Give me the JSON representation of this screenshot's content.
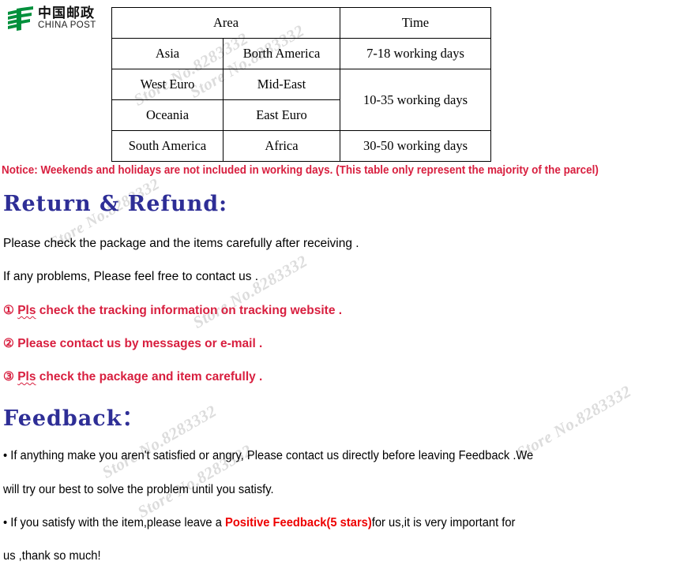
{
  "watermark": {
    "text": "Store No.8283332",
    "color": "#cfcfcf"
  },
  "logo": {
    "name_cn": "中国邮政",
    "name_en": "CHINA POST",
    "emblem_color": "#00903c",
    "emblem_name": "china-post-emblem"
  },
  "shipping_table": {
    "headers": [
      "Area",
      "Time"
    ],
    "rows": [
      {
        "area_left": "Asia",
        "area_right": "Borth America",
        "time": "7-18 working days"
      },
      {
        "area_left": "West Euro",
        "area_right": "Mid-East",
        "time": "10-35 working days"
      },
      {
        "area_left": "Oceania",
        "area_right": "East Euro",
        "time": ""
      },
      {
        "area_left": "South America",
        "area_right": "Africa",
        "time": "30-50 working days"
      }
    ]
  },
  "notice": {
    "text": "Notice: Weekends and holidays are not included in working days. (This table only represent the majority of the parcel)",
    "color": "#d81f3f"
  },
  "return_section": {
    "heading": "Return & Refund:",
    "heading_color": "#2e2e96",
    "paragraphs": [
      "Please check the package and the items carefully after receiving .",
      "If any problems, Please feel free to contact us ."
    ],
    "numbered_items": [
      {
        "marker": "①",
        "pre": "Pls",
        "rest": " check the tracking information on tracking website ."
      },
      {
        "marker": "②",
        "pre": "",
        "rest": "Please contact us by messages or e-mail ."
      },
      {
        "marker": "③",
        "pre": "Pls",
        "rest": " check the package and item carefully ."
      }
    ],
    "item_color": "#d81f3f"
  },
  "feedback_section": {
    "heading": "Feedback：",
    "heading_color": "#2e2e96",
    "bullet": "•",
    "line1": "If anything make you aren't satisfied or angry, Please contact us directly before leaving Feedback .We",
    "line2": "will try our best to solve the problem until you satisfy.",
    "line3_pre": "If you satisfy with the item,please leave a ",
    "line3_highlight": "Positive Feedback(5 stars)",
    "line3_post": "for us,it is very important for",
    "line4": "us ,thank so much!",
    "highlight_color": "#ee0000"
  }
}
